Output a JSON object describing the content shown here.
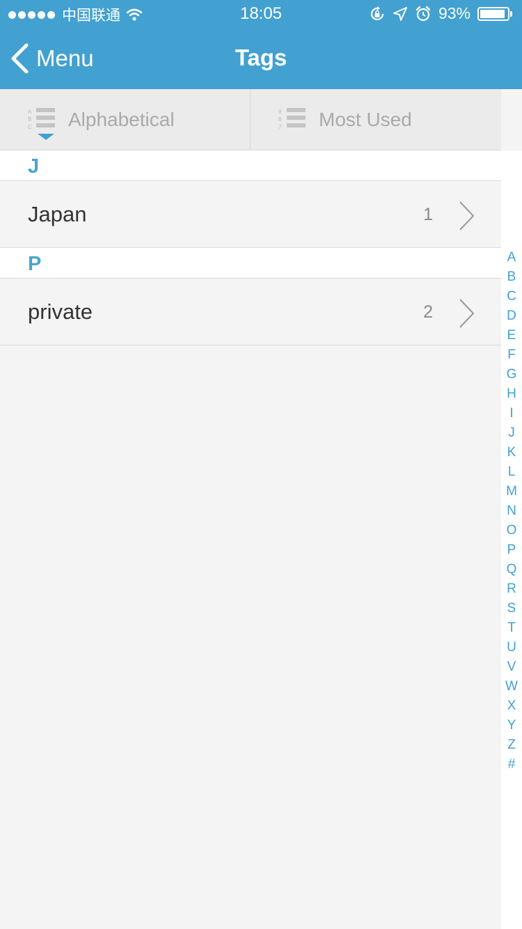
{
  "status_bar": {
    "carrier": "中国联通",
    "time": "18:05",
    "battery_percent": "93%",
    "icons": [
      "signal-dots-icon",
      "wifi-icon",
      "rotation-lock-icon",
      "location-icon",
      "alarm-icon",
      "battery-icon"
    ]
  },
  "nav": {
    "back_label": "Menu",
    "title": "Tags"
  },
  "sort_tabs": {
    "alphabetical": {
      "label": "Alphabetical",
      "icon": "alphabetical-sort-icon",
      "small_letters": [
        "A",
        "B",
        "C"
      ],
      "selected": true
    },
    "most_used": {
      "label": "Most Used",
      "icon": "most-used-sort-icon",
      "small_numbers": [
        "9",
        "8",
        "7"
      ],
      "selected": false
    }
  },
  "sections": [
    {
      "header": "J",
      "rows": [
        {
          "label": "Japan",
          "count": "1"
        }
      ]
    },
    {
      "header": "P",
      "rows": [
        {
          "label": "private",
          "count": "2"
        }
      ]
    }
  ],
  "index_letters": [
    "A",
    "B",
    "C",
    "D",
    "E",
    "F",
    "G",
    "H",
    "I",
    "J",
    "K",
    "L",
    "M",
    "N",
    "O",
    "P",
    "Q",
    "R",
    "S",
    "T",
    "U",
    "V",
    "W",
    "X",
    "Y",
    "Z",
    "#"
  ],
  "colors": {
    "accent": "#42a1d0",
    "background": "#f4f4f4"
  }
}
